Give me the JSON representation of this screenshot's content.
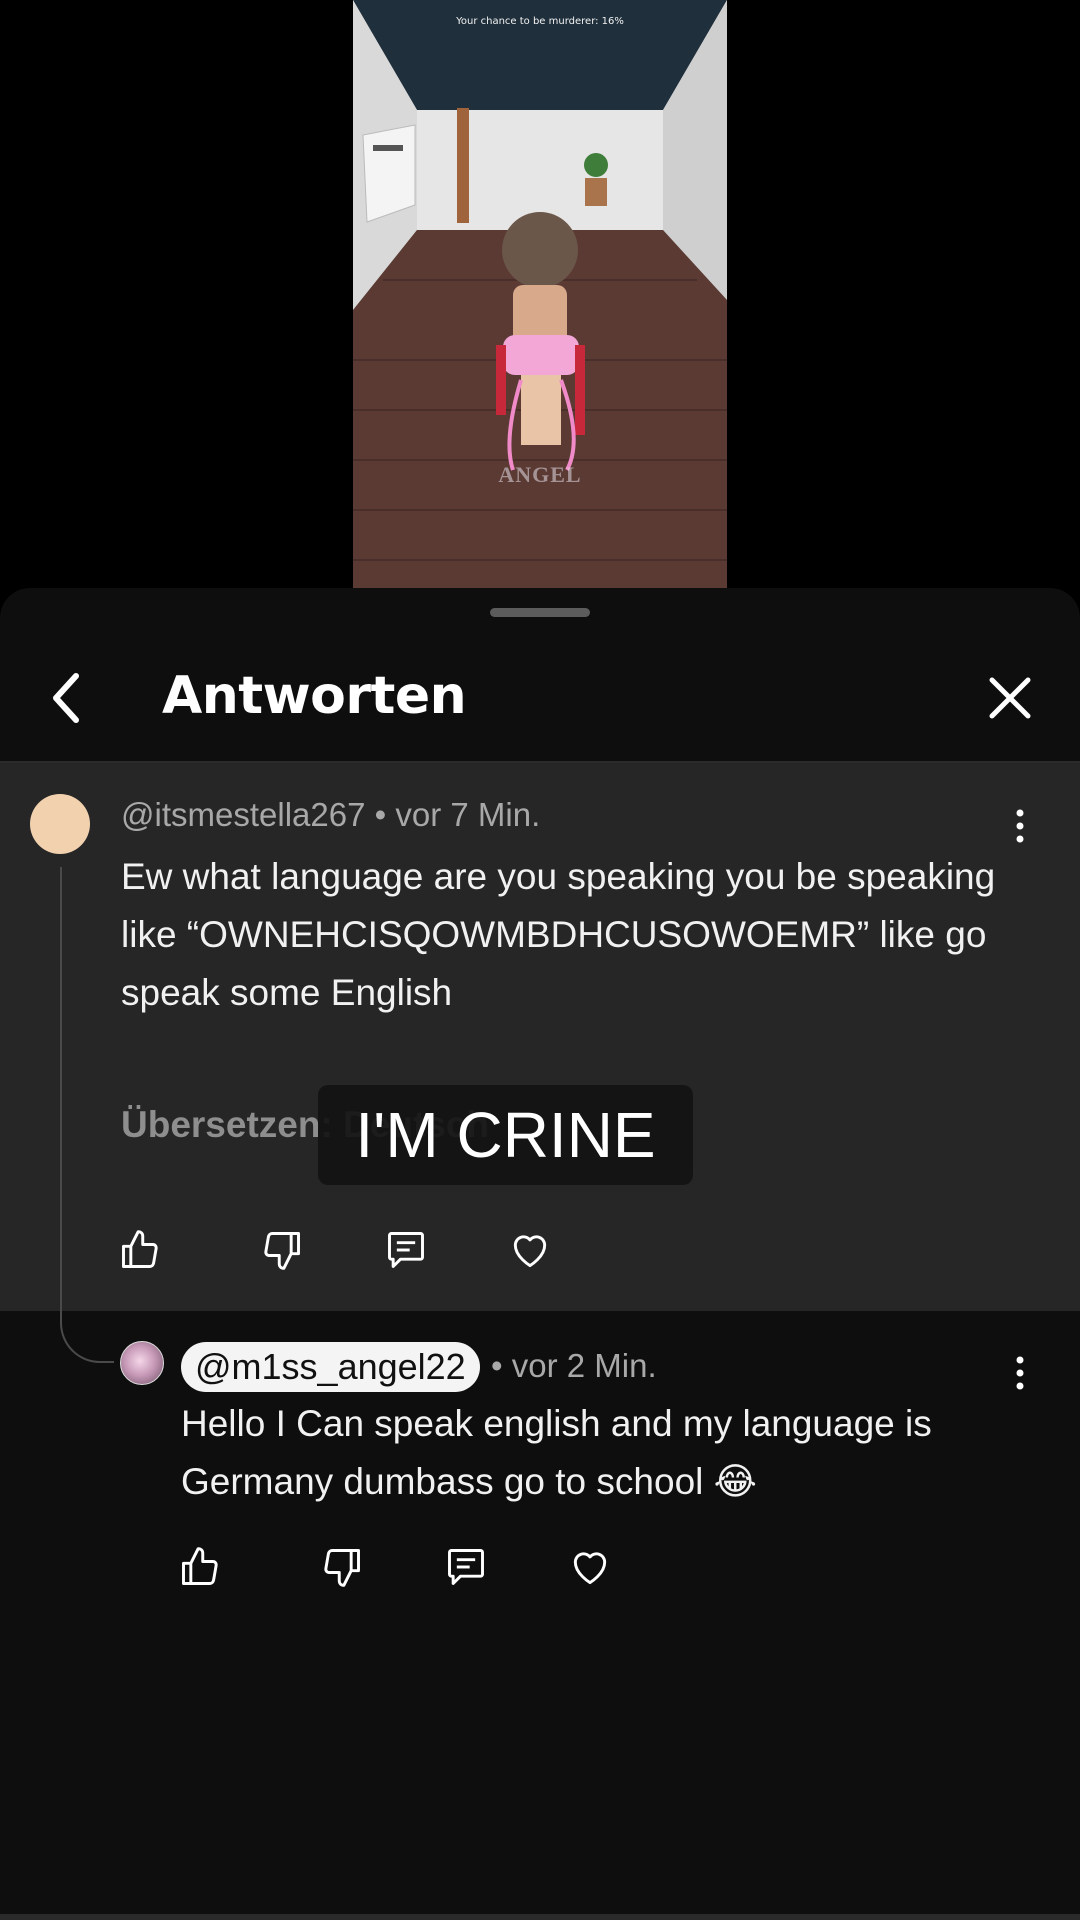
{
  "video": {
    "hud_text": "Your chance to be murderer: 16%",
    "watermark": "ANGEL"
  },
  "sheet": {
    "title": "Antworten"
  },
  "parent_comment": {
    "author": "@itsmestella267",
    "time": "vor 7 Min.",
    "text": "Ew what language are you speaking you be speaking like “OWNEHCISQOWMBDHCUSOWOEMR” like go speak some English",
    "translate": "Übersetzen: Deutsch"
  },
  "overlay_caption": "I'M CRINE",
  "reply_comment": {
    "author": "@m1ss_angel22",
    "time": "vor 2 Min.",
    "text": "Hello I Can speak english and my language is Germany dumbass go to school 😂"
  },
  "icons": [
    "back-icon",
    "close-icon",
    "more-vert-icon",
    "thumb-up-icon",
    "thumb-down-icon",
    "reply-icon",
    "heart-icon"
  ],
  "colors": {
    "sheet_bg": "#0e0e0e",
    "highlight_bg": "#262626",
    "meta_text": "#a8a8a8",
    "avatar_parent": "#f2d2ae"
  }
}
